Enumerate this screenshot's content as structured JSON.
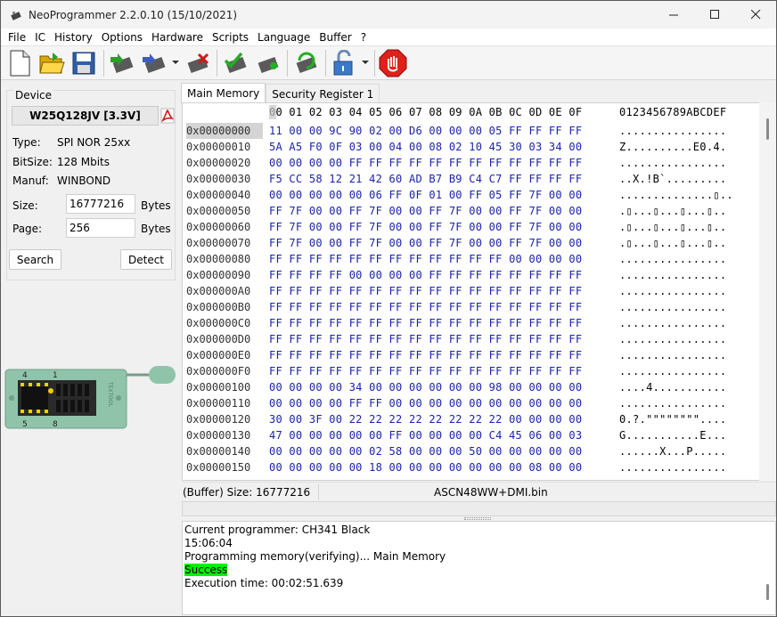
{
  "window": {
    "title": "NeoProgrammer 2.2.0.10 (15/10/2021)"
  },
  "menu": [
    "File",
    "IC",
    "History",
    "Options",
    "Hardware",
    "Scripts",
    "Language",
    "Buffer",
    "?"
  ],
  "toolbar_icons": [
    "new-file-icon",
    "open-folder-icon",
    "save-icon",
    "read-chip-icon",
    "write-chip-icon",
    "erase-chip-icon",
    "verify-chip-icon",
    "blank-check-icon",
    "auto-icon",
    "unlock-icon",
    "stop-icon"
  ],
  "device": {
    "legend": "Device",
    "chip": "W25Q128JV [3.3V]",
    "type_label": "Type:",
    "type_value": "SPI NOR  25xx",
    "bitsize_label": "BitSize:",
    "bitsize_value": "128 Mbits",
    "manuf_label": "Manuf:",
    "manuf_value": "WINBOND",
    "size_label": "Size:",
    "size_value": "16777216",
    "size_unit": "Bytes",
    "page_label": "Page:",
    "page_value": "256",
    "page_unit": "Bytes",
    "search_button": "Search",
    "detect_button": "Detect",
    "programmer_pins": [
      "4",
      "1",
      "5",
      "8"
    ],
    "programmer_brand": "TEXTOOL"
  },
  "tabs": [
    "Main Memory",
    "Security Register 1"
  ],
  "hex": {
    "header_cols": "00 01 02 03 04 05 06 07 08 09 0A 0B 0C 0D 0E 0F",
    "header_ascii": "0123456789ABCDEF",
    "rows": [
      {
        "addr": "0x00000000",
        "bytes": "11 00 00 9C 90 02 00 D6 00 00 00 05 FF FF FF FF",
        "ascii": "................"
      },
      {
        "addr": "0x00000010",
        "bytes": "5A A5 F0 0F 03 00 04 00 08 02 10 45 30 03 34 00",
        "ascii": "Z..........E0.4."
      },
      {
        "addr": "0x00000020",
        "bytes": "00 00 00 00 FF FF FF FF FF FF FF FF FF FF FF FF",
        "ascii": "................"
      },
      {
        "addr": "0x00000030",
        "bytes": "F5 CC 58 12 21 42 60 AD B7 B9 C4 C7 FF FF FF FF",
        "ascii": "..X.!B`........."
      },
      {
        "addr": "0x00000040",
        "bytes": "00 00 00 00 00 06 FF 0F 01 00 FF 05 FF 7F 00 00",
        "ascii": "..............▯.."
      },
      {
        "addr": "0x00000050",
        "bytes": "FF 7F 00 00 FF 7F 00 00 FF 7F 00 00 FF 7F 00 00",
        "ascii": ".▯...▯...▯...▯.."
      },
      {
        "addr": "0x00000060",
        "bytes": "FF 7F 00 00 FF 7F 00 00 FF 7F 00 00 FF 7F 00 00",
        "ascii": ".▯...▯...▯...▯.."
      },
      {
        "addr": "0x00000070",
        "bytes": "FF 7F 00 00 FF 7F 00 00 FF 7F 00 00 FF 7F 00 00",
        "ascii": ".▯...▯...▯...▯.."
      },
      {
        "addr": "0x00000080",
        "bytes": "FF FF FF FF FF FF FF FF FF FF FF FF 00 00 00 00",
        "ascii": "................"
      },
      {
        "addr": "0x00000090",
        "bytes": "FF FF FF FF 00 00 00 00 FF FF FF FF FF FF FF FF",
        "ascii": "................"
      },
      {
        "addr": "0x000000A0",
        "bytes": "FF FF FF FF FF FF FF FF FF FF FF FF FF FF FF FF",
        "ascii": "................"
      },
      {
        "addr": "0x000000B0",
        "bytes": "FF FF FF FF FF FF FF FF FF FF FF FF FF FF FF FF",
        "ascii": "................"
      },
      {
        "addr": "0x000000C0",
        "bytes": "FF FF FF FF FF FF FF FF FF FF FF FF FF FF FF FF",
        "ascii": "................"
      },
      {
        "addr": "0x000000D0",
        "bytes": "FF FF FF FF FF FF FF FF FF FF FF FF FF FF FF FF",
        "ascii": "................"
      },
      {
        "addr": "0x000000E0",
        "bytes": "FF FF FF FF FF FF FF FF FF FF FF FF FF FF FF FF",
        "ascii": "................"
      },
      {
        "addr": "0x000000F0",
        "bytes": "FF FF FF FF FF FF FF FF FF FF FF FF FF FF FF FF",
        "ascii": "................"
      },
      {
        "addr": "0x00000100",
        "bytes": "00 00 00 00 34 00 00 00 00 00 00 98 00 00 00 00",
        "ascii": "....4..........."
      },
      {
        "addr": "0x00000110",
        "bytes": "00 00 00 00 FF FF 00 00 00 00 00 00 00 00 00 00",
        "ascii": "................"
      },
      {
        "addr": "0x00000120",
        "bytes": "30 00 3F 00 22 22 22 22 22 22 22 22 00 00 00 00",
        "ascii": "0.?.\"\"\"\"\"\"\"\"...."
      },
      {
        "addr": "0x00000130",
        "bytes": "47 00 00 00 00 00 FF 00 00 00 00 C4 45 06 00 03",
        "ascii": "G...........E..."
      },
      {
        "addr": "0x00000140",
        "bytes": "00 00 00 00 00 02 58 00 00 00 50 00 00 00 00 00",
        "ascii": "......X...P....."
      },
      {
        "addr": "0x00000150",
        "bytes": "00 00 00 00 00 18 00 00 00 00 00 00 00 08 00 00",
        "ascii": "................"
      }
    ]
  },
  "status": {
    "buffer_size": "(Buffer) Size: 16777216",
    "filename": "ASCN48WW+DMI.bin"
  },
  "log": [
    {
      "text": "Current programmer: CH341 Black"
    },
    {
      "text": "15:06:04"
    },
    {
      "text": "Programming memory(verifying)... Main Memory"
    },
    {
      "text": "Success",
      "highlight": true
    },
    {
      "text": "Execution time: 00:02:51.639"
    }
  ]
}
